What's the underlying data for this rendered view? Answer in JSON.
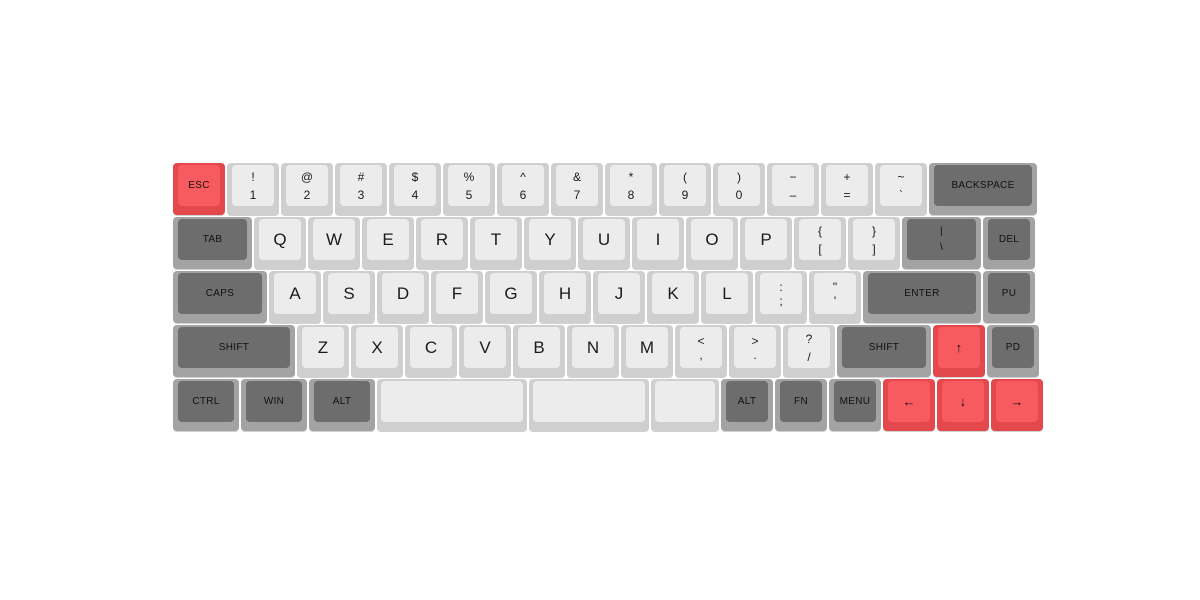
{
  "keyboard": {
    "row1": [
      {
        "l": "ESC",
        "c": "red",
        "w": 52
      },
      {
        "t": "!",
        "b": "1"
      },
      {
        "t": "@",
        "b": "2"
      },
      {
        "t": "#",
        "b": "3"
      },
      {
        "t": "$",
        "b": "4"
      },
      {
        "t": "%",
        "b": "5"
      },
      {
        "t": "^",
        "b": "6"
      },
      {
        "t": "&",
        "b": "7"
      },
      {
        "t": "*",
        "b": "8"
      },
      {
        "t": "(",
        "b": "9"
      },
      {
        "t": ")",
        "b": "0"
      },
      {
        "t": "−",
        "b": "–"
      },
      {
        "t": "+",
        "b": "="
      },
      {
        "t": "~",
        "b": "`"
      },
      {
        "l": "BACKSPACE",
        "c": "dark",
        "w": 108
      }
    ],
    "row2": [
      {
        "l": "TAB",
        "c": "dark",
        "w": 79
      },
      {
        "l": "Q"
      },
      {
        "l": "W"
      },
      {
        "l": "E"
      },
      {
        "l": "R"
      },
      {
        "l": "T"
      },
      {
        "l": "Y"
      },
      {
        "l": "U"
      },
      {
        "l": "I"
      },
      {
        "l": "O"
      },
      {
        "l": "P"
      },
      {
        "t": "{",
        "b": "["
      },
      {
        "t": "}",
        "b": "]"
      },
      {
        "t": "|",
        "b": "\\",
        "c": "dark",
        "w": 79
      },
      {
        "l": "DEL",
        "c": "dark",
        "w": 52
      }
    ],
    "row3": [
      {
        "l": "CAPS",
        "c": "dark",
        "w": 94
      },
      {
        "l": "A"
      },
      {
        "l": "S"
      },
      {
        "l": "D"
      },
      {
        "l": "F"
      },
      {
        "l": "G"
      },
      {
        "l": "H"
      },
      {
        "l": "J"
      },
      {
        "l": "K"
      },
      {
        "l": "L"
      },
      {
        "t": ":",
        "b": ";",
        "big": true
      },
      {
        "t": "\"",
        "b": "'",
        "big": true
      },
      {
        "l": "ENTER",
        "c": "dark",
        "w": 118
      },
      {
        "l": "PU",
        "c": "dark",
        "w": 52
      }
    ],
    "row4": [
      {
        "l": "SHIFT",
        "c": "dark",
        "w": 122
      },
      {
        "l": "Z"
      },
      {
        "l": "X"
      },
      {
        "l": "C"
      },
      {
        "l": "V"
      },
      {
        "l": "B"
      },
      {
        "l": "N"
      },
      {
        "l": "M"
      },
      {
        "t": "<",
        "b": ",",
        "big": true
      },
      {
        "t": ">",
        "b": ".",
        "big": true
      },
      {
        "t": "?",
        "b": "/"
      },
      {
        "l": "SHIFT",
        "c": "dark",
        "w": 94
      },
      {
        "l": "↑",
        "c": "red",
        "w": 52,
        "arrow": true
      },
      {
        "l": "PD",
        "c": "dark",
        "w": 52
      }
    ],
    "row5": [
      {
        "l": "CTRL",
        "c": "dark",
        "w": 66
      },
      {
        "l": "WIN",
        "c": "dark",
        "w": 66
      },
      {
        "l": "ALT",
        "c": "dark",
        "w": 66
      },
      {
        "l": "",
        "c": "light",
        "w": 150,
        "space": true
      },
      {
        "l": "",
        "c": "light",
        "w": 120,
        "space": true
      },
      {
        "l": "",
        "c": "light",
        "w": 68,
        "space": true
      },
      {
        "l": "ALT",
        "c": "dark",
        "w": 52
      },
      {
        "l": "FN",
        "c": "dark",
        "w": 52
      },
      {
        "l": "MENU",
        "c": "dark",
        "w": 52
      },
      {
        "l": "←",
        "c": "red",
        "w": 52,
        "arrow": true
      },
      {
        "l": "↓",
        "c": "red",
        "w": 52,
        "arrow": true
      },
      {
        "l": "→",
        "c": "red",
        "w": 52,
        "arrow": true
      }
    ]
  }
}
